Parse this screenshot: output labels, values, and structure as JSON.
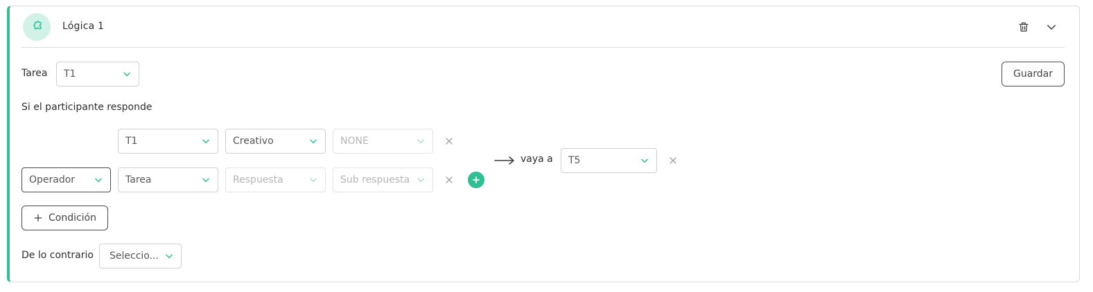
{
  "header": {
    "title": "Lógica 1",
    "icons": [
      "puzzle-icon",
      "trash-icon",
      "chevron-down-icon"
    ]
  },
  "task_row": {
    "label": "Tarea",
    "task_value": "T1",
    "save_label": "Guardar"
  },
  "condition_section": {
    "title": "Si el participante responde",
    "row1": {
      "task": "T1",
      "answer": "Creativo",
      "subanswer": "NONE"
    },
    "row2": {
      "operator_placeholder": "Operador",
      "task_placeholder": "Tarea",
      "answer_placeholder": "Respuesta",
      "subanswer_placeholder": "Sub respuesta"
    },
    "goto_label": "vaya a",
    "goto_value": "T5",
    "add_condition_label": "Condición"
  },
  "else_row": {
    "label": "De lo contrario",
    "placeholder": "Seleccio..."
  },
  "colors": {
    "accent": "#2fbf94",
    "accent_light": "#d2f2e8",
    "border": "#cfcfcf"
  }
}
